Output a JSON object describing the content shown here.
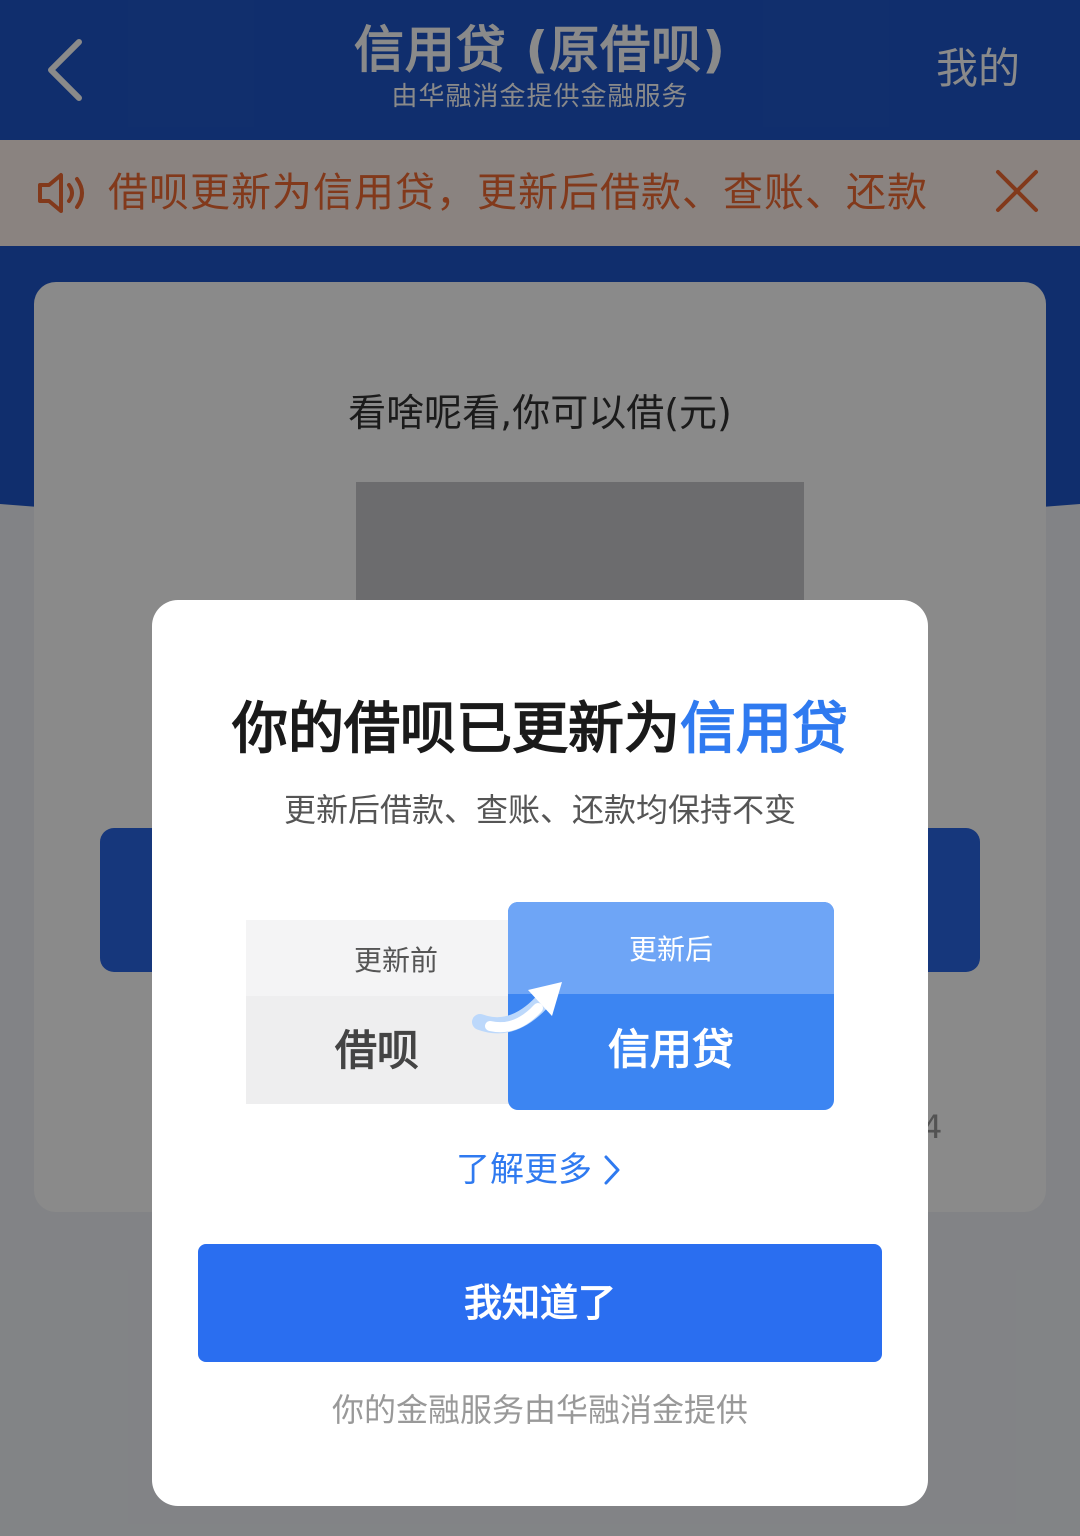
{
  "header": {
    "title": "信用贷 (原借呗)",
    "subtitle": "由华融消金提供金融服务",
    "mine_label": "我的",
    "back_icon": "chevron-left-icon"
  },
  "notice": {
    "icon": "speaker-icon",
    "text": "借呗更新为信用贷，更新后借款、查账、还款",
    "close_icon": "close-icon"
  },
  "card": {
    "quota_label": "看啥呢看,你可以借(元)",
    "footnote_digit": "4"
  },
  "dialog": {
    "title_prefix": "你的借呗已更新为",
    "title_highlight": "信用贷",
    "subtitle": "更新后借款、查账、还款均保持不变",
    "before_label": "更新前",
    "before_value": "借呗",
    "after_label": "更新后",
    "after_value": "信用贷",
    "learn_more": "了解更多",
    "confirm_button": "我知道了",
    "footer": "你的金融服务由华融消金提供"
  },
  "colors": {
    "brand_blue": "#1f56c9",
    "accent_blue": "#2f7af0",
    "notice_orange": "#f06a32"
  }
}
